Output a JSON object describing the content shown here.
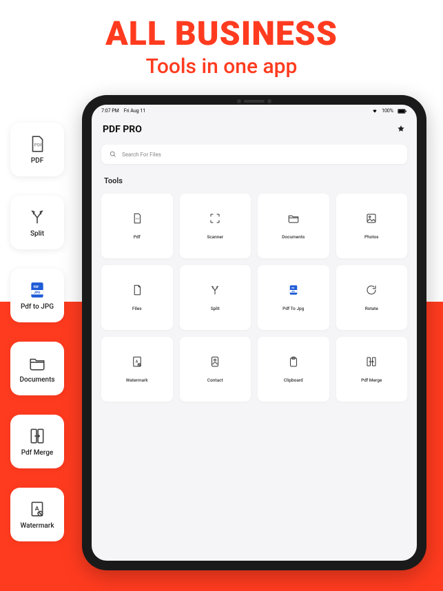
{
  "headline": {
    "title": "ALL BUSINESS",
    "subtitle": "Tools in one app"
  },
  "sidebar": [
    {
      "label": "PDF",
      "icon": "pdf-file-icon"
    },
    {
      "label": "Split",
      "icon": "split-icon"
    },
    {
      "label": "Pdf to JPG",
      "icon": "pdf-to-jpg-icon"
    },
    {
      "label": "Documents",
      "icon": "folder-icon"
    },
    {
      "label": "Pdf Merge",
      "icon": "merge-icon"
    },
    {
      "label": "Watermark",
      "icon": "watermark-icon"
    }
  ],
  "tablet": {
    "status": {
      "time": "7:07 PM",
      "date": "Fri Aug 11",
      "battery": "100%"
    },
    "app_title": "PDF PRO",
    "search_placeholder": "Search For Files",
    "section": "Tools",
    "tools": [
      {
        "label": "Pdf",
        "icon": "pdf-file-icon"
      },
      {
        "label": "Scanner",
        "icon": "scanner-icon"
      },
      {
        "label": "Documents",
        "icon": "folder-icon"
      },
      {
        "label": "Photos",
        "icon": "photo-icon"
      },
      {
        "label": "Files",
        "icon": "file-icon"
      },
      {
        "label": "Split",
        "icon": "split-icon"
      },
      {
        "label": "Pdf To Jpg",
        "icon": "pdf-to-jpg-icon"
      },
      {
        "label": "Rotate",
        "icon": "rotate-icon"
      },
      {
        "label": "Watermark",
        "icon": "watermark-icon"
      },
      {
        "label": "Contact",
        "icon": "contact-icon"
      },
      {
        "label": "Clipboard",
        "icon": "clipboard-icon"
      },
      {
        "label": "Pdf Merge",
        "icon": "merge-icon"
      }
    ]
  }
}
